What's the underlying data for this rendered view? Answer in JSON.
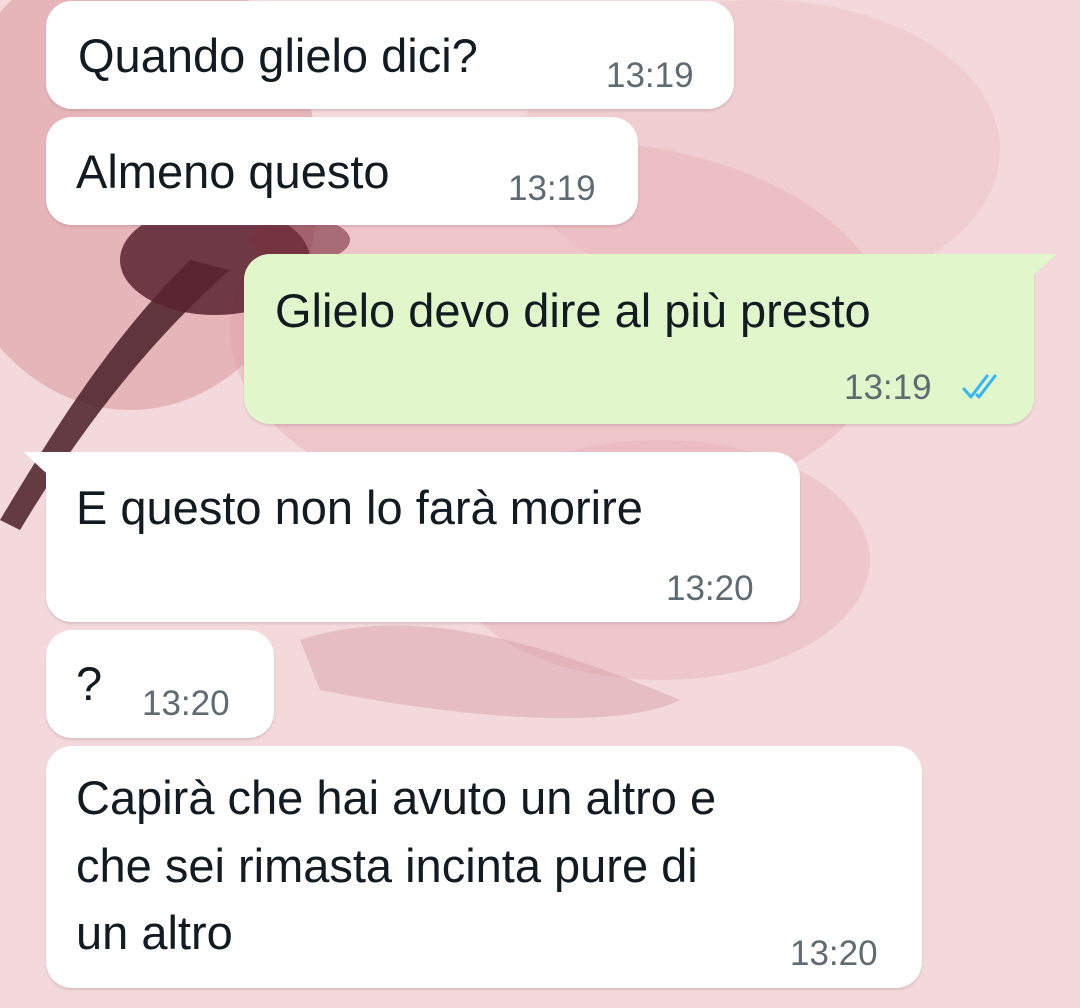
{
  "colors": {
    "incoming_bubble": "#ffffff",
    "outgoing_bubble": "#e1f7cb",
    "text": "#111b21",
    "timestamp": "#5f6b72",
    "read_ticks": "#34b7f1",
    "wallpaper": "#f3d9dc"
  },
  "messages": [
    {
      "direction": "incoming",
      "text": "Quando glielo dici?",
      "time": "13:19"
    },
    {
      "direction": "incoming",
      "text": "Almeno questo",
      "time": "13:19"
    },
    {
      "direction": "outgoing",
      "text": "Glielo devo dire al più presto",
      "time": "13:19",
      "status_icon": "double-check-read-icon"
    },
    {
      "direction": "incoming",
      "text": "E questo non lo farà morire",
      "time": "13:20"
    },
    {
      "direction": "incoming",
      "text": "?",
      "time": "13:20"
    },
    {
      "direction": "incoming",
      "text_lines": [
        "Capirà che hai avuto un altro e",
        "che sei rimasta incinta pure di",
        "un altro"
      ],
      "time": "13:20"
    }
  ]
}
